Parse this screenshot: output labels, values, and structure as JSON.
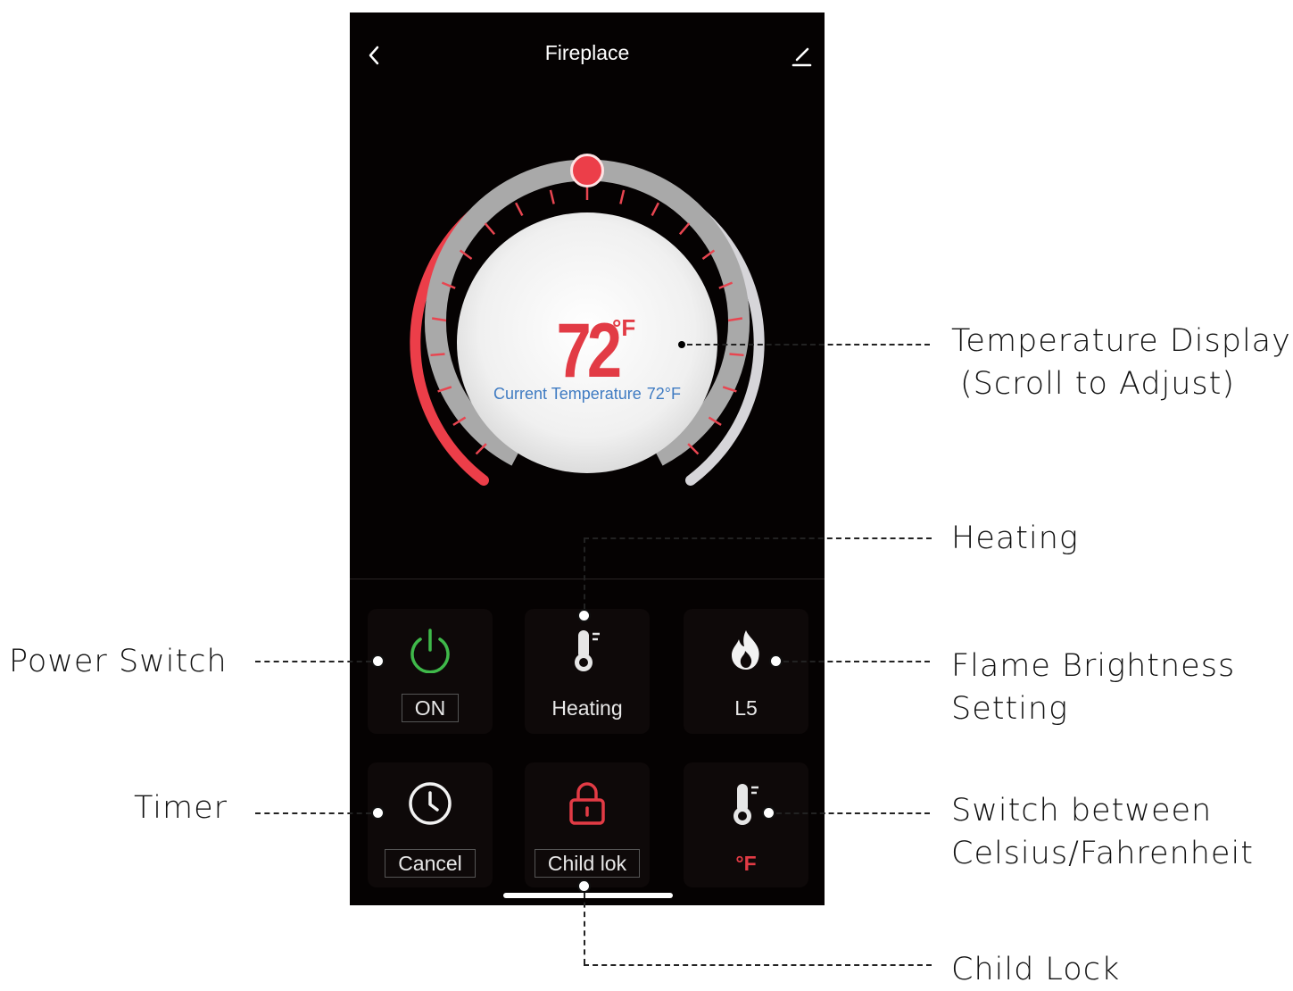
{
  "app": {
    "title": "Fireplace",
    "back_icon": "chevron-left-icon",
    "edit_icon": "pencil-icon"
  },
  "thermostat": {
    "set_temperature": "72",
    "unit": "°F",
    "current_label": "Current Temperature",
    "current_value": "72°F",
    "accent_color": "#e23b45"
  },
  "controls": {
    "power": {
      "icon": "power-icon",
      "label": "ON",
      "icon_color": "#3fb94a"
    },
    "mode": {
      "icon": "thermometer-icon",
      "label": "Heating"
    },
    "flame": {
      "icon": "flame-icon",
      "label": "L5"
    },
    "timer": {
      "icon": "clock-icon",
      "label": "Cancel"
    },
    "child_lock": {
      "icon": "lock-icon",
      "label": "Child lok",
      "icon_color": "#e23b45"
    },
    "unit_switch": {
      "icon": "thermometer-icon",
      "label": "°F"
    }
  },
  "callouts": {
    "temperature_display": [
      "Temperature Display",
      "(Scroll to Adjust)"
    ],
    "heating": "Heating",
    "power_switch": "Power Switch",
    "flame_brightness": [
      "Flame Brightness",
      "Setting"
    ],
    "timer": "Timer",
    "unit_switch": [
      "Switch between",
      "Celsius/Fahrenheit"
    ],
    "child_lock": "Child Lock"
  }
}
